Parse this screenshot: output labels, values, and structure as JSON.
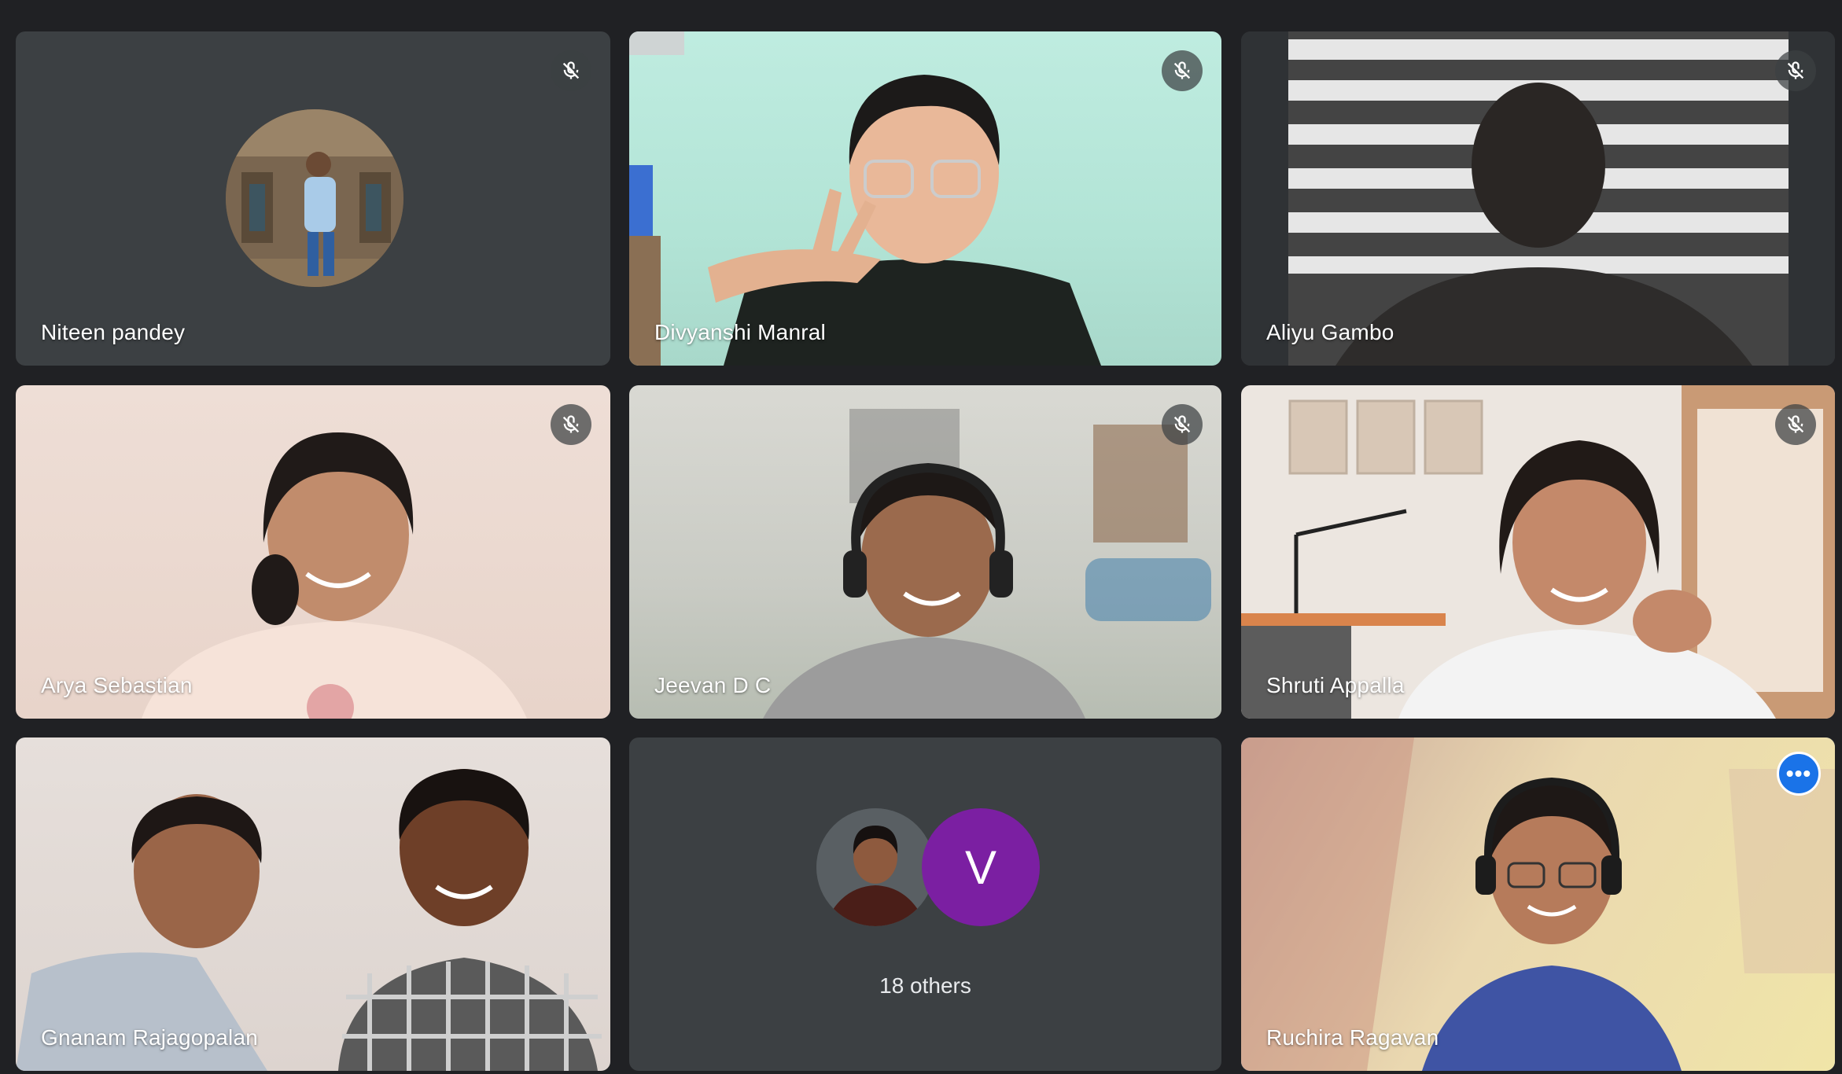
{
  "participants": [
    {
      "name": "Niteen pandey",
      "muted": true,
      "type": "avatar"
    },
    {
      "name": "Divyanshi Manral",
      "muted": true,
      "type": "video"
    },
    {
      "name": "Aliyu Gambo",
      "muted": true,
      "type": "video"
    },
    {
      "name": "Arya Sebastian",
      "muted": true,
      "type": "video"
    },
    {
      "name": "Jeevan D C",
      "muted": true,
      "type": "video"
    },
    {
      "name": "Shruti Appalla",
      "muted": true,
      "type": "video"
    },
    {
      "name": "Gnanam Rajagopalan",
      "muted": false,
      "type": "video"
    },
    {
      "name": "Ruchira Ragavan",
      "muted": false,
      "type": "video",
      "active": true
    }
  ],
  "others": {
    "label": "18 others",
    "letter_avatar": "V",
    "letter_avatar_color": "#7b1fa2"
  },
  "icons": {
    "mute": "mic-off-icon",
    "more": "more-options-icon"
  },
  "colors": {
    "background": "#202124",
    "tile": "#3c4043",
    "active_border": "#8ab4f8",
    "accent": "#1a73e8"
  }
}
